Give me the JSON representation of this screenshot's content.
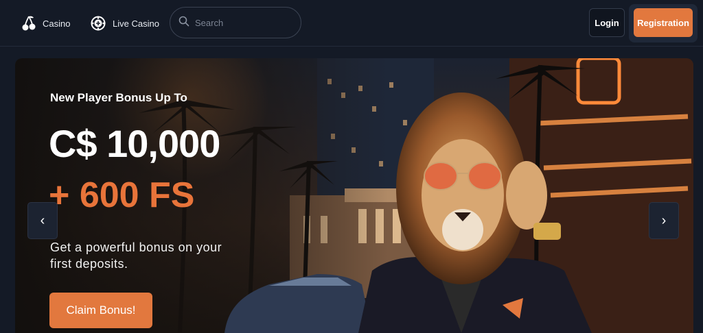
{
  "nav": {
    "casino_label": "Casino",
    "live_casino_label": "Live Casino",
    "casino_icon": "cherries-icon",
    "live_icon": "roulette-chip-icon"
  },
  "search": {
    "placeholder": "Search",
    "icon": "search-icon"
  },
  "auth": {
    "login_label": "Login",
    "register_label": "Registration"
  },
  "hero": {
    "subtitle": "New Player Bonus Up To",
    "amount": "C$ 10,000",
    "free_spins": "+ 600 FS",
    "description": "Get a powerful bonus on your first deposits.",
    "cta_label": "Claim Bonus!",
    "prev_icon": "chevron-left-icon",
    "next_icon": "chevron-right-icon",
    "prev_glyph": "‹",
    "next_glyph": "›"
  },
  "colors": {
    "background": "#141a26",
    "accent": "#e2783e",
    "accent_text": "#e8743a",
    "text": "#ffffff"
  }
}
